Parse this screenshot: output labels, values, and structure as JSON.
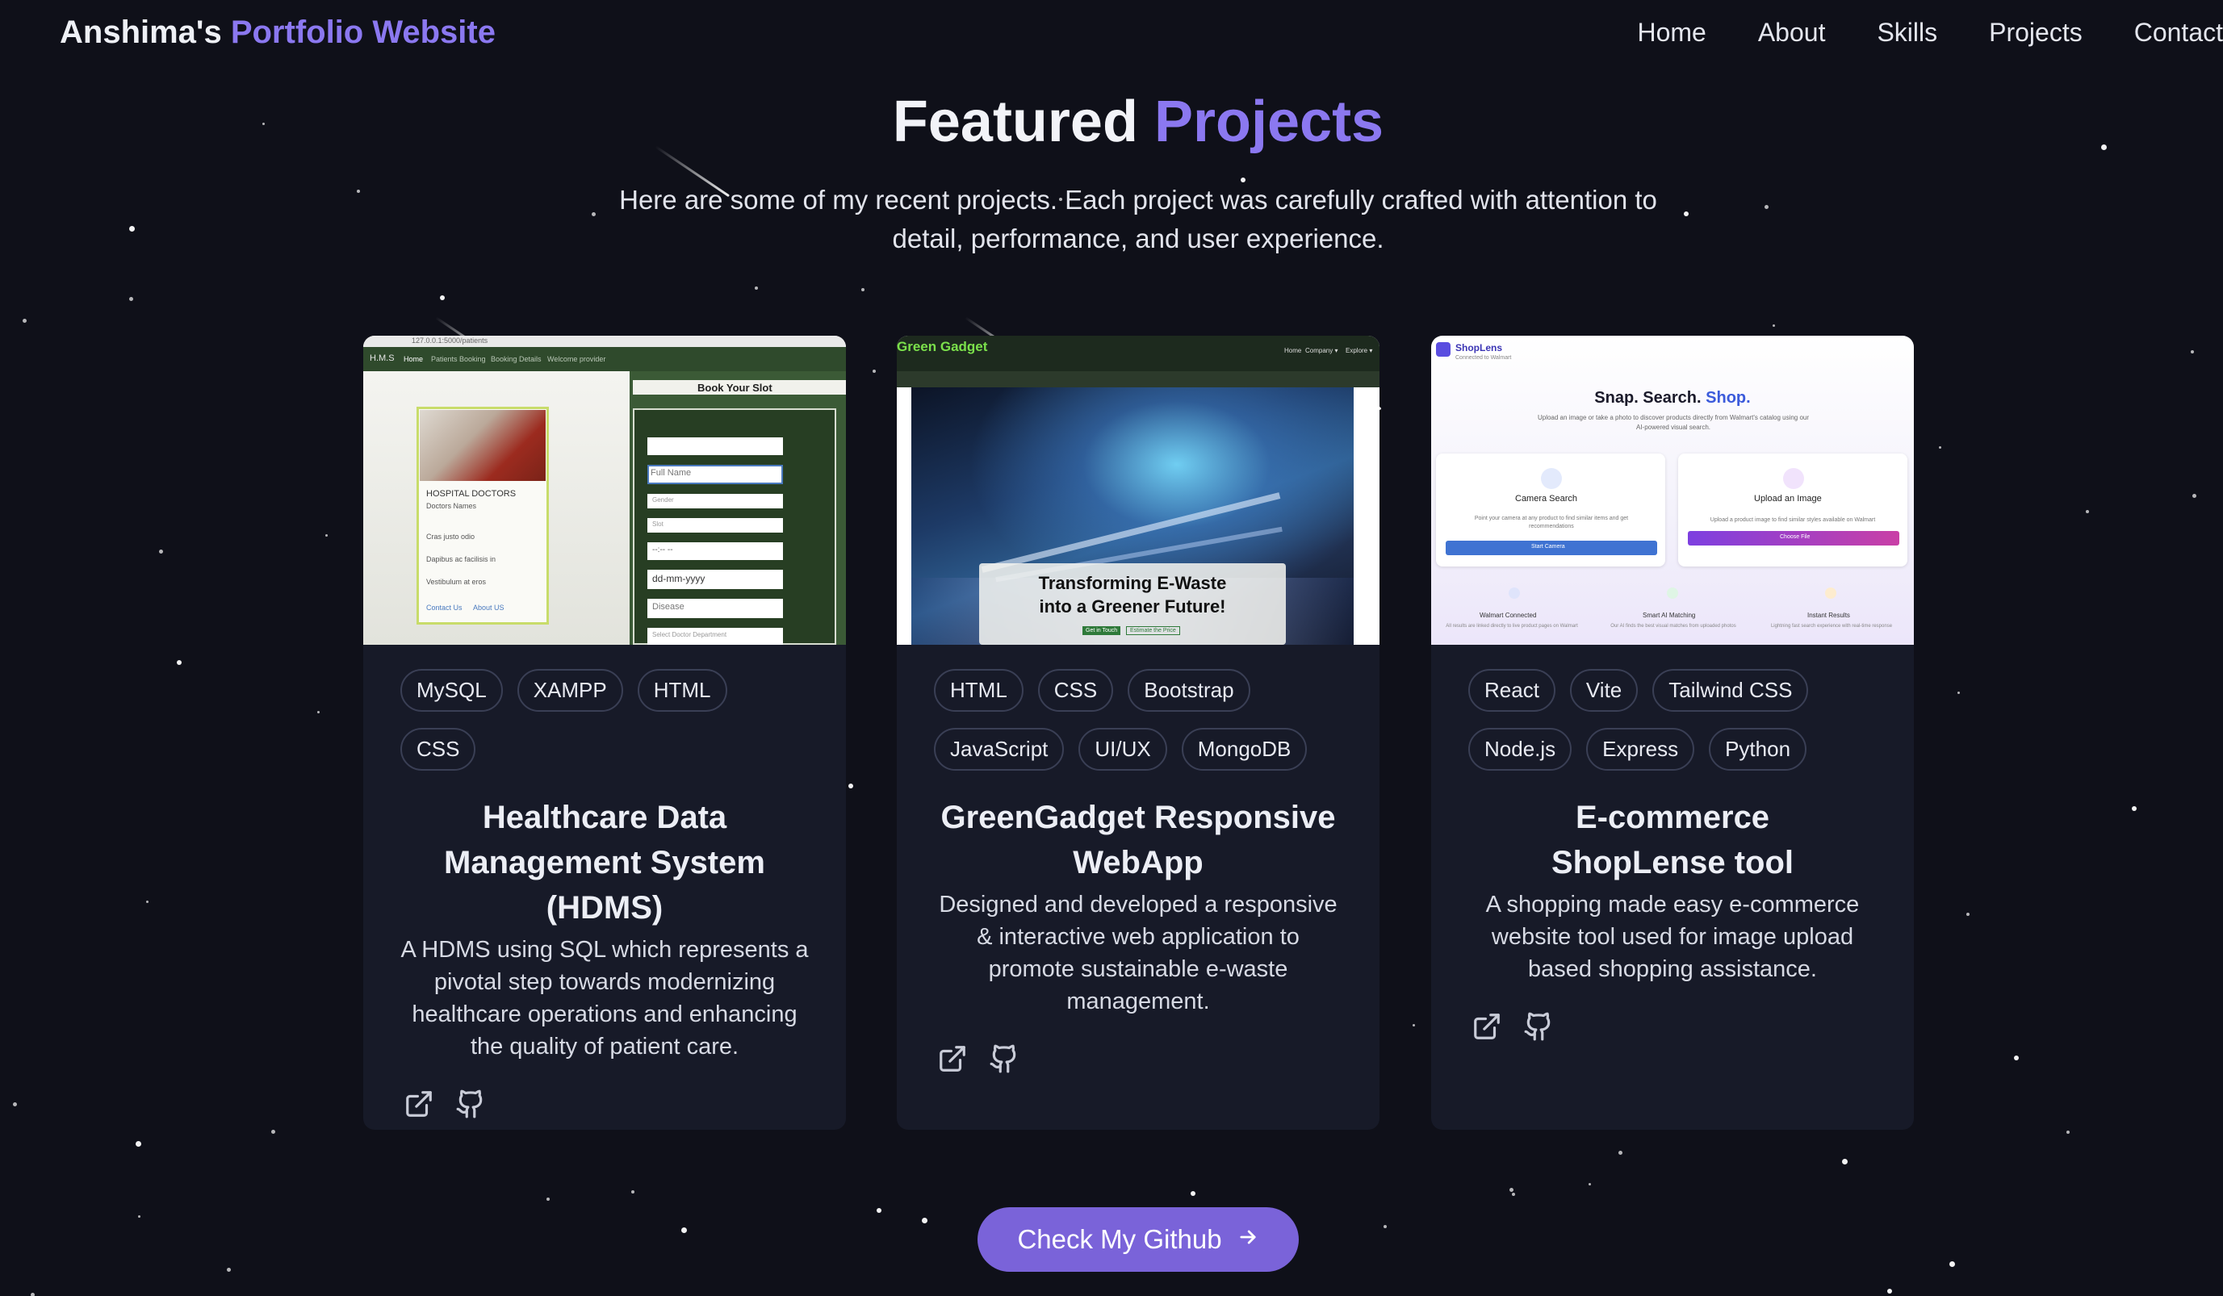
{
  "nav": {
    "brand_prefix": "Anshima's",
    "brand_accent": "Portfolio Website",
    "links": [
      "Home",
      "About",
      "Skills",
      "Projects",
      "Contact"
    ]
  },
  "hero": {
    "title_prefix": "Featured",
    "title_accent": "Projects",
    "subtitle": "Here are some of my recent projects. Each project was carefully crafted with attention to detail, performance, and user experience."
  },
  "projects": [
    {
      "title": "Healthcare Data Management System (HDMS)",
      "description": "A HDMS using SQL which represents a pivotal step towards modernizing healthcare operations and enhancing the quality of patient care.",
      "tags": [
        "MySQL",
        "XAMPP",
        "HTML",
        "CSS"
      ],
      "preview": {
        "url": "127.0.0.1:5000/patients",
        "nav_logo": "H.M.S",
        "nav_items": [
          "Home",
          "Patients Booking",
          "Booking Details",
          "Welcome provider"
        ],
        "panel_heading": "HOSPITAL DOCTORS",
        "panel_sub": "Doctors Names",
        "panel_items": [
          "Cras justo odio",
          "Dapibus ac facilisis in",
          "Vestibulum at eros"
        ],
        "panel_footer": [
          "Contact Us",
          "About US"
        ],
        "form_title": "Book Your Slot",
        "form_fields": [
          "Full Name",
          "Gender",
          "Slot",
          "--:-- --",
          "dd-mm-yyyy",
          "Disease",
          "Select Doctor Department"
        ]
      }
    },
    {
      "title": "GreenGadget Responsive WebApp",
      "description": "Designed and developed a responsive & interactive web application to promote sustainable e-waste management.",
      "tags": [
        "HTML",
        "CSS",
        "Bootstrap",
        "JavaScript",
        "UI/UX",
        "MongoDB"
      ],
      "preview": {
        "logo": "Green Gadget",
        "nav_items": [
          "Home",
          "Company ▾",
          "Explore ▾"
        ],
        "headline": "Transforming E-Waste into a Greener Future!",
        "buttons": [
          "Get in Touch",
          "Estimate the Price"
        ]
      }
    },
    {
      "title": "E-commerce ShopLense tool",
      "description": "A shopping made easy e-commerce website tool used for image upload based shopping assistance.",
      "tags": [
        "React",
        "Vite",
        "Tailwind CSS",
        "Node.js",
        "Express",
        "Python"
      ],
      "preview": {
        "logo": "ShopLens",
        "logo_sub": "Connected to Walmart",
        "headline_a": "Snap. Search.",
        "headline_b": "Shop.",
        "blurb": "Upload an image or take a photo to discover products directly from Walmart's catalog using our AI-powered visual search.",
        "camera_title": "Camera Search",
        "camera_text": "Point your camera at any product to find similar items and get recommendations",
        "camera_button": "Start Camera",
        "upload_title": "Upload an Image",
        "upload_text": "Upload a product image to find similar styles available on Walmart",
        "upload_button": "Choose File",
        "features": [
          {
            "title": "Walmart Connected",
            "text": "All results are linked directly to live product pages on Walmart"
          },
          {
            "title": "Smart AI Matching",
            "text": "Our AI finds the best visual matches from uploaded photos"
          },
          {
            "title": "Instant Results",
            "text": "Lightning fast search experience with real-time response"
          }
        ]
      }
    }
  ],
  "cta": {
    "label": "Check My Github",
    "arrow": "→"
  },
  "icons": [
    "external-link-icon",
    "github-icon",
    "arrow-right-icon"
  ],
  "colors": {
    "background": "#0f1019",
    "card": "#171a28",
    "accent": "#8b78f0",
    "button": "#7a63d9"
  }
}
